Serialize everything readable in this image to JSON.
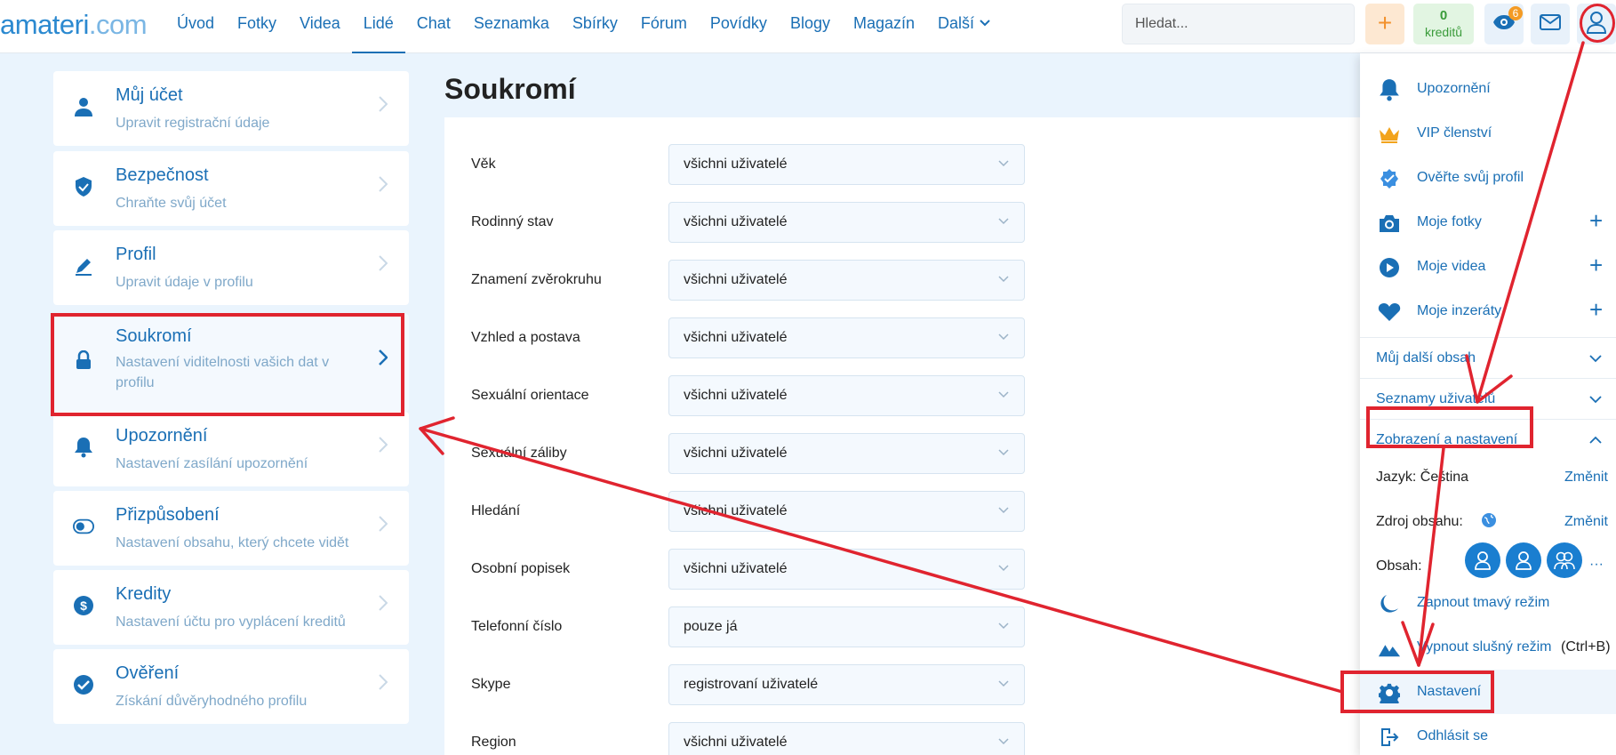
{
  "site": {
    "logo_main": "amateri",
    "logo_domain": ".com"
  },
  "nav": [
    {
      "label": "Úvod",
      "active": false
    },
    {
      "label": "Fotky",
      "active": false
    },
    {
      "label": "Videa",
      "active": false
    },
    {
      "label": "Lidé",
      "active": true
    },
    {
      "label": "Chat",
      "active": false
    },
    {
      "label": "Seznamka",
      "active": false
    },
    {
      "label": "Sbírky",
      "active": false
    },
    {
      "label": "Fórum",
      "active": false
    },
    {
      "label": "Povídky",
      "active": false
    },
    {
      "label": "Blogy",
      "active": false
    },
    {
      "label": "Magazín",
      "active": false
    }
  ],
  "nav_more": "Další",
  "search": {
    "placeholder": "Hledat..."
  },
  "header": {
    "add_label": "+",
    "credits_value": "0",
    "credits_label": "kreditů",
    "notifications_count": "6"
  },
  "sidebar": {
    "items": [
      {
        "title": "Můj účet",
        "subtitle": "Upravit registrační údaje",
        "icon": "user-icon"
      },
      {
        "title": "Bezpečnost",
        "subtitle": "Chraňte svůj účet",
        "icon": "shield-icon"
      },
      {
        "title": "Profil",
        "subtitle": "Upravit údaje v profilu",
        "icon": "pencil-icon"
      },
      {
        "title": "Soukromí",
        "subtitle": "Nastavení viditelnosti vašich dat v profilu",
        "icon": "lock-icon",
        "active": true
      },
      {
        "title": "Upozornění",
        "subtitle": "Nastavení zasílání upozornění",
        "icon": "bell-icon"
      },
      {
        "title": "Přizpůsobení",
        "subtitle": "Nastavení obsahu, který chcete vidět",
        "icon": "toggle-icon"
      },
      {
        "title": "Kredity",
        "subtitle": "Nastavení účtu pro vyplácení kreditů",
        "icon": "dollar-icon"
      },
      {
        "title": "Ověření",
        "subtitle": "Získání důvěryhodného profilu",
        "icon": "check-circle-icon"
      }
    ]
  },
  "main": {
    "title": "Soukromí",
    "rows": [
      {
        "label": "Věk",
        "value": "všichni uživatelé"
      },
      {
        "label": "Rodinný stav",
        "value": "všichni uživatelé"
      },
      {
        "label": "Znamení zvěrokruhu",
        "value": "všichni uživatelé"
      },
      {
        "label": "Vzhled a postava",
        "value": "všichni uživatelé"
      },
      {
        "label": "Sexuální orientace",
        "value": "všichni uživatelé"
      },
      {
        "label": "Sexuální záliby",
        "value": "všichni uživatelé"
      },
      {
        "label": "Hledání",
        "value": "všichni uživatelé"
      },
      {
        "label": "Osobní popisek",
        "value": "všichni uživatelé"
      },
      {
        "label": "Telefonní číslo",
        "value": "pouze já"
      },
      {
        "label": "Skype",
        "value": "registrovaní uživatelé"
      },
      {
        "label": "Region",
        "value": "všichni uživatelé"
      }
    ]
  },
  "dropdown": {
    "items": [
      {
        "label": "Upozornění",
        "icon": "bell-icon"
      },
      {
        "label": "VIP členství",
        "icon": "crown-icon"
      },
      {
        "label": "Ověřte svůj profil",
        "icon": "verified-icon"
      },
      {
        "label": "Moje fotky",
        "icon": "camera-icon",
        "plus": "+"
      },
      {
        "label": "Moje videa",
        "icon": "play-icon",
        "plus": "+"
      },
      {
        "label": "Moje inzeráty",
        "icon": "heart-icon",
        "plus": "+"
      }
    ],
    "section_more": "Můj další obsah",
    "section_lists": "Seznamy uživatelů",
    "section_display": "Zobrazení a nastavení",
    "language_label": "Jazyk: Čeština",
    "language_change": "Změnit",
    "source_label": "Zdroj obsahu:",
    "source_change": "Změnit",
    "content_label": "Obsah:",
    "content_more": "···",
    "dark_mode": "Zapnout tmavý režim",
    "decent_mode": "Vypnout slušný režim",
    "decent_shortcut": "(Ctrl+B)",
    "settings": "Nastavení",
    "logout": "Odhlásit se"
  },
  "colors": {
    "accent": "#1a6fb5",
    "annotation": "#e0242f",
    "credits": "#3a9b3a",
    "add": "#f2912c"
  }
}
